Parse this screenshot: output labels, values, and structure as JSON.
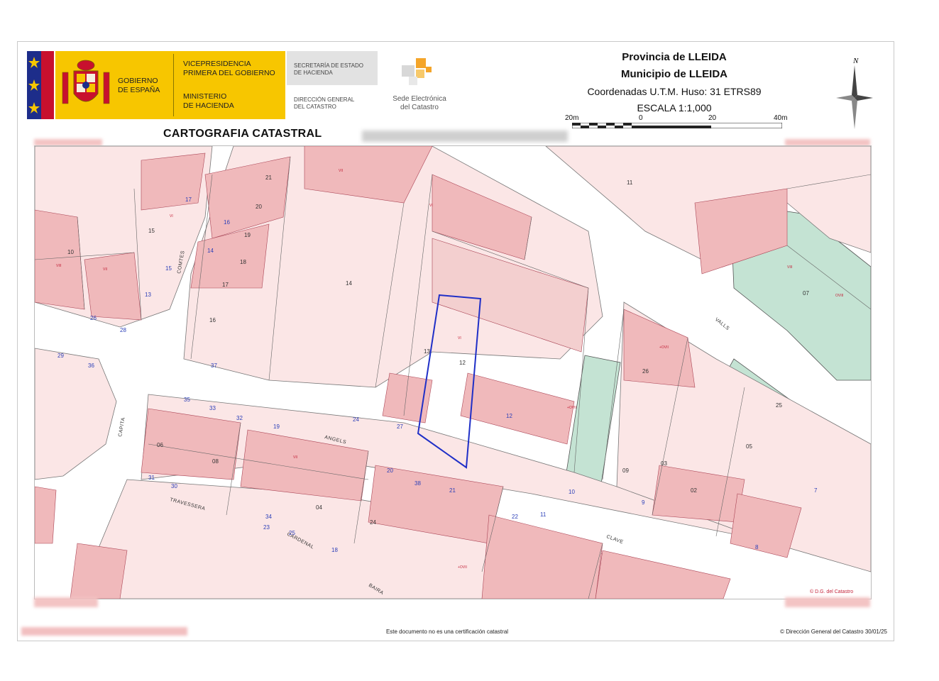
{
  "header": {
    "gov_line1": "Gobierno",
    "gov_line2": "de España",
    "vice_line1": "Vicepresidencia",
    "vice_line2": "Primera del Gobierno",
    "min_line1": "Ministerio",
    "min_line2": "de Hacienda",
    "sec_line1": "Secretaría de Estado",
    "sec_line2": "de Hacienda",
    "dir_line1": "Dirección General",
    "dir_line2": "del Catastro",
    "sede_line1": "Sede Electrónica",
    "sede_line2": "del Catastro",
    "title": "CARTOGRAFIA CATASTRAL",
    "province": "Provincia de LLEIDA",
    "municipality": "Municipio de LLEIDA",
    "coordinates": "Coordenadas U.T.M. Huso: 31 ETRS89",
    "scale": "ESCALA 1:1,000",
    "scale_ticks": [
      "20m",
      "0",
      "20",
      "40m"
    ],
    "north": "N"
  },
  "map": {
    "streets": [
      "COMTES",
      "VALLS",
      "ANGELS",
      "CAPITA",
      "CLAVE",
      "TRAVESSERA",
      "CARDENAL",
      "BAIRA"
    ],
    "parcel_numbers": [
      "14",
      "15",
      "16",
      "17",
      "18",
      "19",
      "20",
      "21",
      "11",
      "12",
      "13",
      "05",
      "07",
      "08",
      "09",
      "10",
      "24",
      "25",
      "26",
      "06",
      "03",
      "02",
      "04"
    ],
    "house_numbers": [
      "17",
      "16",
      "15",
      "14",
      "13",
      "12",
      "11",
      "10",
      "9",
      "8",
      "7",
      "26",
      "28",
      "29",
      "30",
      "31",
      "32",
      "33",
      "34",
      "35",
      "36",
      "37",
      "38",
      "19",
      "20",
      "21",
      "22",
      "23",
      "24",
      "25",
      "27",
      "18"
    ],
    "copyright_mark": "© D.G. del Catastro",
    "highlight_color": "#1f2fc7",
    "building_color": "#f0b9bb",
    "green_color": "#c4e3d3"
  },
  "footer": {
    "disclaimer": "Este documento no es una certificación catastral",
    "copyright": "© Dirección General del Catastro 30/01/25"
  }
}
